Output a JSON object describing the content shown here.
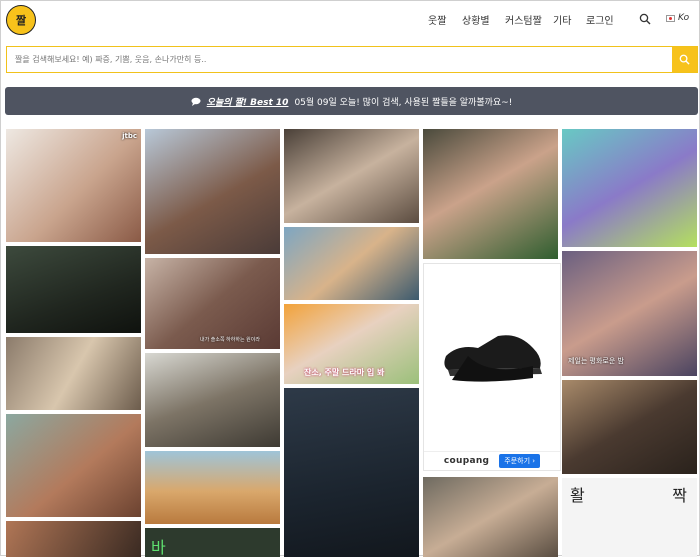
{
  "header": {
    "logo_text": "짤",
    "nav": [
      {
        "label": "웃짤"
      },
      {
        "label": "상황별"
      },
      {
        "label": "커스텀짤"
      },
      {
        "label": "기타"
      },
      {
        "label": "로그인"
      }
    ],
    "lang_label": "Ko"
  },
  "search": {
    "placeholder": "짤을 검색해보세요! 예) 짜증, 기쁨, 웃음, 손나가만히 등.."
  },
  "banner": {
    "best_label": "오늘의 짤! Best 10",
    "date_text": "05월 09일 오늘! 많이 검색, 사용된 짤들을 알까볼까요~!"
  },
  "ad": {
    "brand": "coupang",
    "buy_label": "주문하기 ›"
  },
  "tiles": {
    "jtbc_badge": "jtbc",
    "caption_drama": "내가 솔소쪽 하하하는 원이라",
    "caption_show": "잔소, 주말 드라마 입 봐",
    "caption_peace": "제일는 평화로운 밤",
    "text_hwal": "활",
    "text_jjak": "짝",
    "text_ba": "바"
  },
  "colors": {
    "accent": "#f7c21b",
    "banner_bg": "#4f5461"
  }
}
